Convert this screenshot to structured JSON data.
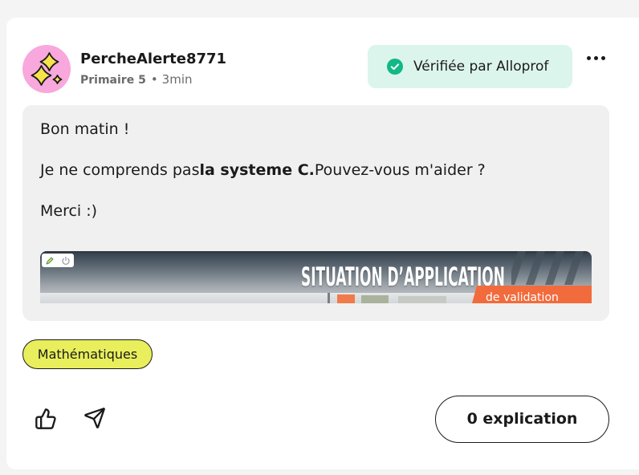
{
  "post": {
    "author": {
      "username": "PercheAlerte8771",
      "grade": "Primaire 5",
      "separator": "•",
      "time": "3min",
      "avatar_icon": "sparkles-icon"
    },
    "verified_badge": {
      "label": "Vérifiée par Alloprof",
      "icon": "check-circle-icon"
    },
    "menu_icon": "more-horizontal-icon",
    "body": {
      "line1": "Bon matin !",
      "line2_prefix": "Je ne comprends pas",
      "line2_bold": "la systeme C.",
      "line2_suffix": "Pouvez-vous m'aider ?",
      "line3": "Merci :)"
    },
    "attachment": {
      "heading": "SITUATION D’APPLICATION",
      "ribbon_text": "de validation",
      "toolbar_icons": [
        "pencil-icon",
        "power-icon"
      ]
    },
    "subject_tag": "Mathématiques",
    "actions": {
      "like_icon": "thumbs-up-icon",
      "share_icon": "send-icon",
      "explanations_button": "0 explication"
    }
  },
  "colors": {
    "page_background": "#f4f4f4",
    "card_background": "#ffffff",
    "avatar_background": "#f8a8dc",
    "sparkle_fill": "#f6e34b",
    "badge_background": "#dcf5ec",
    "verified_green": "#12b886",
    "content_background": "#f0f0f0",
    "tag_background": "#e9ef5c",
    "text_primary": "#1a1a1a",
    "text_secondary": "#6b6b6b",
    "ribbon_orange": "#f26b3c"
  }
}
